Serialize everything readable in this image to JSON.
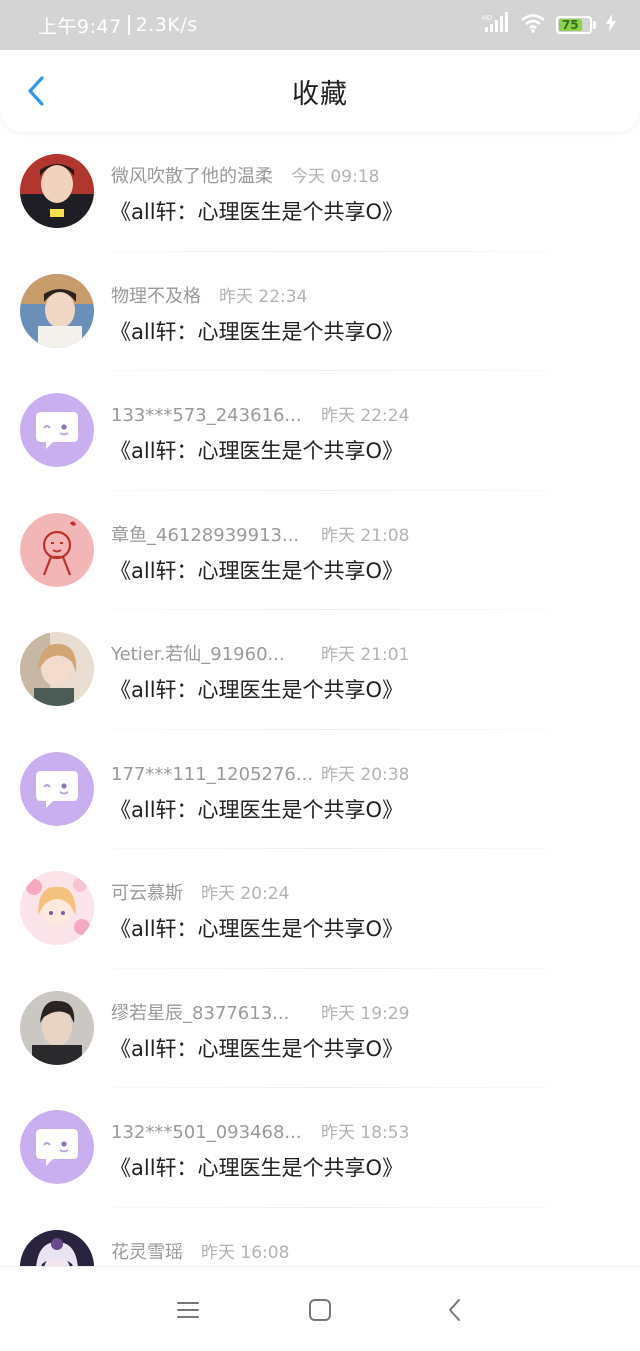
{
  "status_bar": {
    "time": "上午9:47",
    "speed": "2.3K/s",
    "network": "HD",
    "battery": "75",
    "battery_level": 0.75
  },
  "header": {
    "title": "收藏",
    "back_icon": "chevron-left-icon"
  },
  "items": [
    {
      "name": "微风吹散了他的温柔",
      "time": "今天 09:18",
      "message": "《all轩：心理医生是个共享O》",
      "avatar": "photo"
    },
    {
      "name": "物理不及格",
      "time": "昨天 22:34",
      "message": "《all轩：心理医生是个共享O》",
      "avatar": "photo"
    },
    {
      "name": "133***573_243616...",
      "time": "昨天 22:24",
      "message": "《all轩：心理医生是个共享O》",
      "avatar": "default-chat-bubble"
    },
    {
      "name": "章鱼_46128939913...",
      "time": "昨天 21:08",
      "message": "《all轩：心理医生是个共享O》",
      "avatar": "drawing"
    },
    {
      "name": "Yetier.若仙_91960...",
      "time": "昨天 21:01",
      "message": "《all轩：心理医生是个共享O》",
      "avatar": "photo"
    },
    {
      "name": "177***111_1205276...",
      "time": "昨天 20:38",
      "message": "《all轩：心理医生是个共享O》",
      "avatar": "default-chat-bubble"
    },
    {
      "name": "可云慕斯",
      "time": "昨天 20:24",
      "message": "《all轩：心理医生是个共享O》",
      "avatar": "photo"
    },
    {
      "name": "缪若星辰_8377613...",
      "time": "昨天 19:29",
      "message": "《all轩：心理医生是个共享O》",
      "avatar": "photo"
    },
    {
      "name": "132***501_093468...",
      "time": "昨天 18:53",
      "message": "《all轩：心理医生是个共享O》",
      "avatar": "default-chat-bubble"
    },
    {
      "name": "花灵雪瑶",
      "time": "昨天 16:08",
      "message": "",
      "avatar": "photo"
    }
  ],
  "nav_bar": {
    "menu_icon": "menu-icon",
    "home_icon": "home-square-icon",
    "back_icon": "back-triangle-icon"
  },
  "colors": {
    "accent": "#2a9ae8",
    "default_avatar": "#c9aef0",
    "status_bar": "#d4d4d4"
  }
}
